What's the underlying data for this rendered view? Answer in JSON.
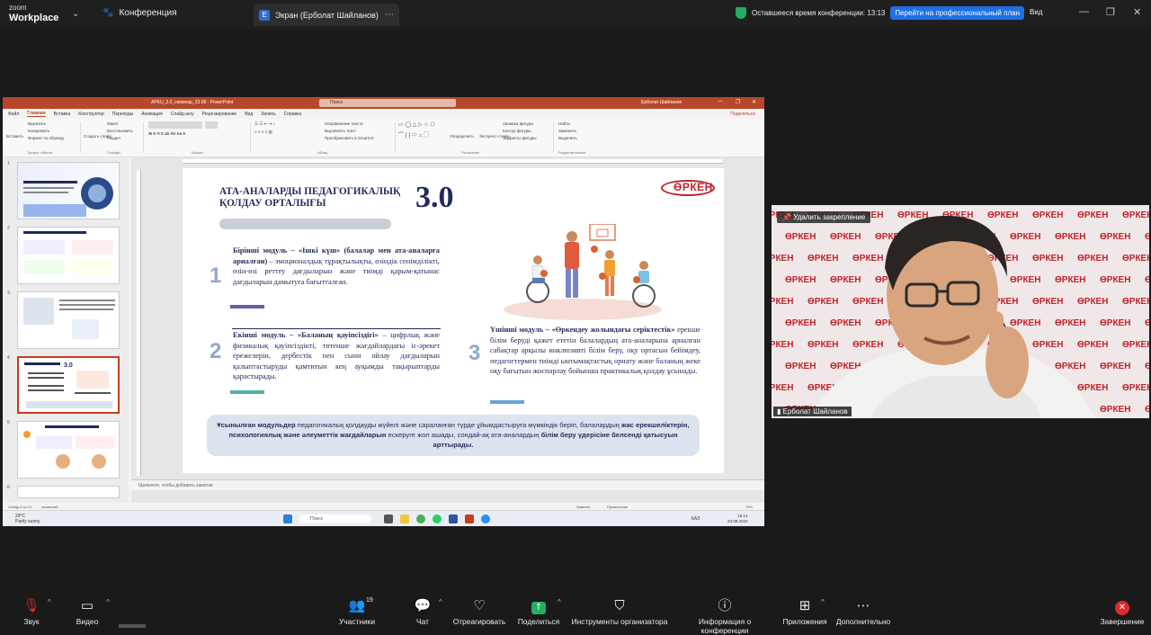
{
  "zoom": {
    "brand_top": "zoom",
    "brand_bottom": "Workplace",
    "conference_label": "Конференция",
    "tab_title": "Экран (Ерболат Шайланов)",
    "tab_icon_letter": "E",
    "time_left": "Оставшееся время конференции: 13:13",
    "upgrade": "Перейти на профессиональный план",
    "view": "Вид"
  },
  "ppt": {
    "file_name": "APKU_3.0_семинар_23.08 - PowerPoint",
    "search": "Поиск",
    "user": "Ерболат Шайланов",
    "menu": [
      "Файл",
      "Главная",
      "Вставка",
      "Конструктор",
      "Переходы",
      "Анимация",
      "Слайд-шоу",
      "Рецензирование",
      "Вид",
      "Запись",
      "Справка"
    ],
    "active_menu": "Главная",
    "share": "Поделиться",
    "ribbon": {
      "paste": "Вставить",
      "cut": "Вырезать",
      "copy": "Копировать",
      "format": "Формат по образцу",
      "clipboard": "Буфер обмена",
      "new_slide": "Создать слайд",
      "layout": "Макет",
      "reset": "Восстановить",
      "section": "Раздел",
      "slides": "Слайды",
      "font": "Шрифт",
      "paragraph": "Абзац",
      "text_dir": "Направление текста",
      "align_text": "Выровнять текст",
      "smartart": "Преобразовать в SmartArt",
      "arrange": "Упорядочить",
      "quick_styles": "Экспресс-стили",
      "fill": "Заливка фигуры",
      "outline": "Контур фигуры",
      "effects": "Эффекты фигуры",
      "drawing": "Рисование",
      "find": "Найти",
      "replace": "Заменить",
      "select": "Выделить",
      "editing": "Редактирование"
    },
    "notes_placeholder": "Щелкните, чтобы добавить заметки",
    "status_left": "Слайд 4 из 10",
    "status_lang": "казахский",
    "status_notes": "Заметки",
    "status_comments": "Примечания",
    "zoom_pct": "76%",
    "taskbar": {
      "weather_temp": "29°C",
      "weather_desc": "Partly sunny",
      "search": "Поиск",
      "lang": "КАЗ",
      "time": "15:14",
      "date": "23.08.2023"
    },
    "thumb_numbers": [
      "1",
      "2",
      "3",
      "4",
      "5",
      "6"
    ]
  },
  "slide": {
    "title": "АТА-АНАЛАРДЫ ПЕДАГОГИКАЛЫҚ ҚОЛДАУ ОРТАЛЫҒЫ",
    "big_number": "3.0",
    "logo_text": "ӨРКЕН",
    "m1_num": "1",
    "m1_title": "Бірінші модуль – «Ішкі күш» (балалар мен ата-аналарға арналған)",
    "m1_body": " – эмоционалдық тұрақтылықты, өзіндік сенімділікті, өзін-өзі реттеу дағдыларын және тиімді қарым-қатынас дағдыларын дамытуға бағытталған.",
    "m2_num": "2",
    "m2_title": "Екінші модуль – «Баланың қауіпсіздігі»",
    "m2_body": " – цифрлық және физикалық қауіпсіздікті, төтенше жағдайлардағы іс-әрекет ережелерін, дербестік пен сыни ойлау дағдыларын қалыптастыруды қамтитын кең ауқымды тақырыптарды қарастырады.",
    "m3_num": "3",
    "m3_title": "Үшінші модуль – «Өркендеу жолындағы серіктестік»",
    "m3_body": " ерекше білім беруді қажет ететін балалардың ата-аналарына арналған сабақтар арқылы инклюзивті білім беру, оқу ортасын бейімдеу, педагогтермен тиімді ынтымақтастық орнату және баланың жеке оқу бағытын жоспарлау бойынша практикалық қолдау ұсынады.",
    "bottom_b1": "Ұсынылған модульдер",
    "bottom_t1": " педагогикалық қолдауды жүйелі және сараланған түрде ұйымдастыруға мүмкіндік беріп, балалардың ",
    "bottom_b2": "жас ерекшеліктерін, психологиялық және әлеуметтік жағдайларын",
    "bottom_t2": " ескеруге жол ашады, сондай-ақ ата-аналардың ",
    "bottom_b3": "білім беру үдерісіне белсенді қатысуын арттырады.",
    "colors": {
      "navy": "#1f2a5a",
      "purple": "#6b5aa6",
      "teal": "#4fb3a5",
      "blue": "#6aa3d5",
      "red": "#c0242b"
    }
  },
  "video": {
    "unpin": "Удалить закрепление",
    "name": "Ерболат Шайланов",
    "wall_logo": "ӨРКЕН"
  },
  "footer": {
    "audio": "Звук",
    "video": "Видео",
    "participants": "Участники",
    "participants_count": "19",
    "chat": "Чат",
    "react": "Отреагировать",
    "share": "Поделиться",
    "host_tools": "Инструменты организатора",
    "info": "Информация о конференции",
    "apps": "Приложения",
    "more": "Дополнительно",
    "end": "Завершение"
  }
}
